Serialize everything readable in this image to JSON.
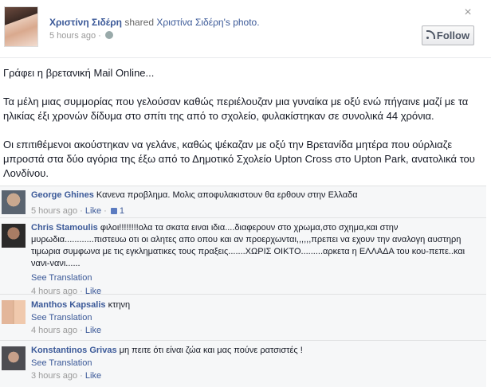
{
  "post": {
    "author": "Χριστίνη Σιδέρη",
    "shared_text": "shared",
    "shared_from": "Χριστίνα Σιδέρη's photo.",
    "time": "5 hours ago",
    "follow_label": "Follow",
    "close_glyph": "×",
    "paragraphs": [
      "Γράφει η βρετανική Mail Online...",
      "Τα μέλη μιας συμμορίας που γελούσαν καθώς περιέλουζαν μια γυναίκα με οξύ ενώ πήγαινε μαζί με τα ηλικίας έξι χρονών δίδυμα στο σπίτι της από το σχολείο, φυλακίστηκαν σε συνολικά 44 χρόνια.",
      "Οι επιτιθέμενοι ακούστηκαν να γελάνε, καθώς ψέκαζαν με οξύ την Βρετανίδα μητέρα που ούρλιαζε μπροστά στα δύο αγόρια της έξω από το Δημοτικό Σχολείο Upton Cross στο Upton Park, ανατολικά του Λονδίνου."
    ]
  },
  "comments": [
    {
      "name": "George Ghines",
      "text": "Κανενα προβλημα. Μολις αποφυλακιστουν θα ερθουν στην Ελλαδα",
      "time": "5 hours ago",
      "like": "Like",
      "likes_count": "1",
      "see_translation": ""
    },
    {
      "name": "Chris Stamoulis",
      "text": "φιλοι!!!!!!!!ολα τα σκατα ειναι ιδια....διαφερουν στο χρωμα,στο σχημα,και στην μυρωδια............πιστευω οτι οι αλητες απο οπου και αν προερχωνται,,,,,,πρεπει να εχουν την αναλογη αυστηρη τιμωρια συμφωνα με τις εγκληματικες τους πραξεις.......ΧΩΡΙΣ ΟΙΚΤΟ.........αρκετα η ΕΛΛΑΔΑ του κου-πεπε..και νανι-νανι......",
      "time": "4 hours ago",
      "like": "Like",
      "see_translation": "See Translation"
    },
    {
      "name": "Manthos Kapsalis",
      "text": "κτηνη",
      "time": "4 hours ago",
      "like": "Like",
      "see_translation": "See Translation"
    },
    {
      "name": "Konstantinos Grivas",
      "text": "μη πειτε ότι είναι ζώα και μας πούνε ρατσιστές !",
      "time": "3 hours ago",
      "like": "Like",
      "see_translation": "See Translation"
    }
  ],
  "meta_separator": " · "
}
